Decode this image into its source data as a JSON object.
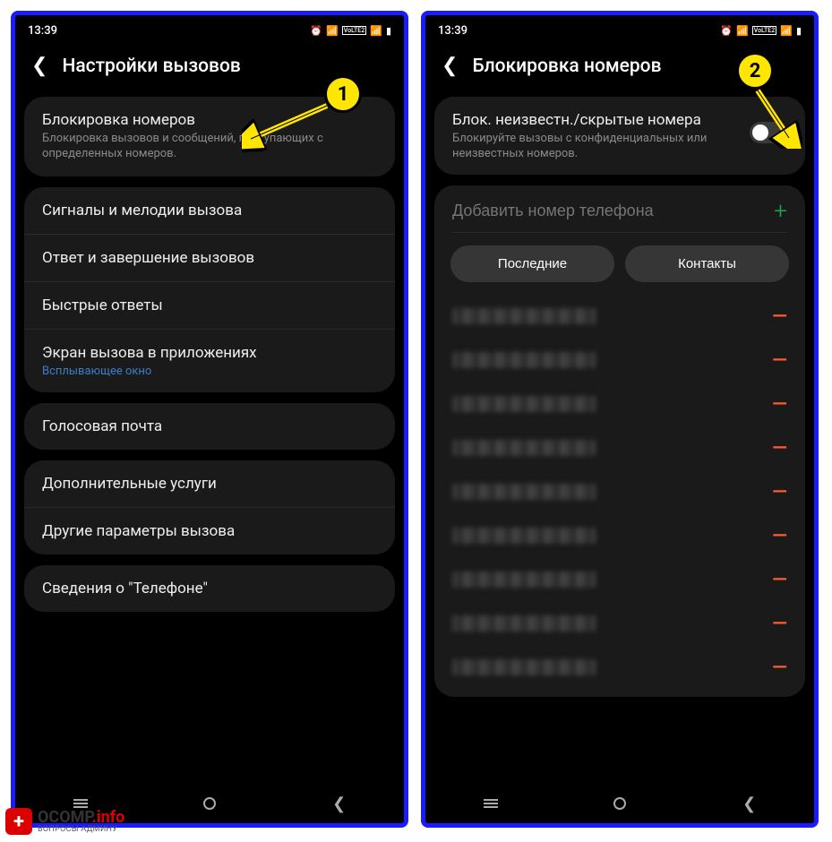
{
  "status": {
    "time": "13:39",
    "volte": "VoLTE2",
    "signal": "▮"
  },
  "screen1": {
    "title": "Настройки вызовов",
    "block_numbers": {
      "title": "Блокировка номеров",
      "sub": "Блокировка вызовов и сообщений, поступающих с определенных номеров."
    },
    "items_group2": [
      "Сигналы и мелодии вызова",
      "Ответ и завершение вызовов",
      "Быстрые ответы"
    ],
    "call_screen": {
      "title": "Экран вызова в приложениях",
      "sub": "Всплывающее окно"
    },
    "voicemail": "Голосовая почта",
    "items_group4": [
      "Дополнительные услуги",
      "Другие параметры вызова"
    ],
    "about": "Сведения о \"Телефоне\""
  },
  "screen2": {
    "title": "Блокировка номеров",
    "block_unknown": {
      "title": "Блок. неизвестн./скрытые номера",
      "sub": "Блокируйте вызовы с конфиденциальных или неизвестных номеров."
    },
    "add_placeholder": "Добавить номер телефона",
    "btn_recent": "Последние",
    "btn_contacts": "Контакты",
    "blocked_count": 9
  },
  "callouts": {
    "one": "1",
    "two": "2"
  },
  "watermark": {
    "main_a": "OCOMP",
    "main_b": ".info",
    "sub": "ВОПРОСЫ АДМИНУ"
  }
}
